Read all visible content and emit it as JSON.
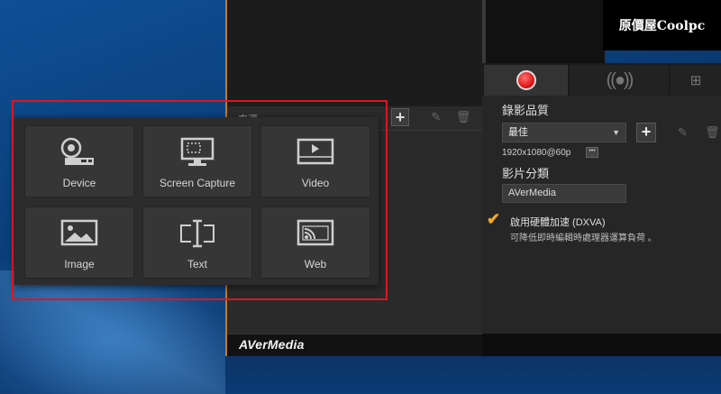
{
  "watermark": "原價屋Coolpc",
  "toolbar": {
    "label": "來源"
  },
  "brand": {
    "logo_text": "AVerMedia"
  },
  "right_panel": {
    "quality_title": "錄影品質",
    "quality_select": "最佳",
    "resolution": "1920x1080@60p",
    "category_title": "影片分類",
    "category_value": "AVerMedia",
    "hw_accel_label": "啟用硬體加速 (DXVA)",
    "hw_accel_note": "可降低即時編輯時處理器運算負荷 。",
    "hw_accel_checked": true
  },
  "sources": [
    {
      "label": "Device",
      "icon": "webcam-icon"
    },
    {
      "label": "Screen Capture",
      "icon": "screen-capture-icon"
    },
    {
      "label": "Video",
      "icon": "video-play-icon"
    },
    {
      "label": "Image",
      "icon": "image-icon"
    },
    {
      "label": "Text",
      "icon": "text-cursor-icon"
    },
    {
      "label": "Web",
      "icon": "cast-icon"
    }
  ],
  "colors": {
    "highlight": "#e0141c",
    "record": "#e01818",
    "check": "#f2a81f",
    "accent_border": "#c47a1c"
  }
}
